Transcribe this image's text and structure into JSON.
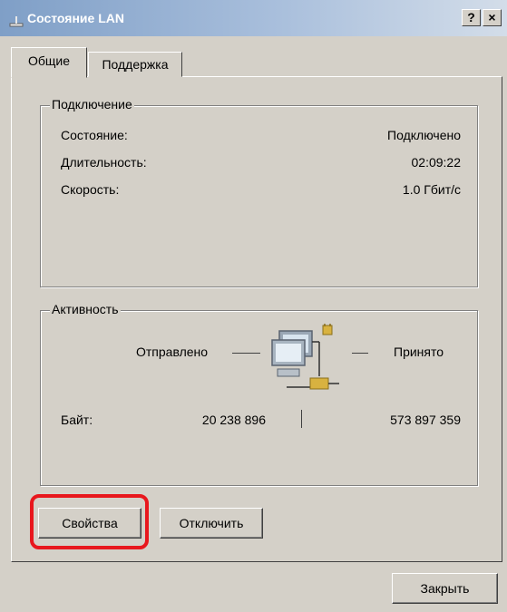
{
  "window": {
    "title": "Состояние LAN",
    "help_button": "?",
    "close_button": "×"
  },
  "tabs": [
    {
      "label": "Общие"
    },
    {
      "label": "Поддержка"
    }
  ],
  "connection": {
    "title": "Подключение",
    "rows": [
      {
        "label": "Состояние:",
        "value": "Подключено"
      },
      {
        "label": "Длительность:",
        "value": "02:09:22"
      },
      {
        "label": "Скорость:",
        "value": "1.0 Гбит/с"
      }
    ]
  },
  "activity": {
    "title": "Активность",
    "sent_label": "Отправлено",
    "received_label": "Принято",
    "bytes_label": "Байт:",
    "bytes_sent": "20 238 896",
    "bytes_received": "573 897 359",
    "icon": "network-computers-icon"
  },
  "buttons": {
    "properties": "Свойства",
    "disable": "Отключить",
    "close": "Закрыть"
  },
  "colors": {
    "highlight": "#e8171d",
    "dialog_bg": "#d4d0c8"
  }
}
